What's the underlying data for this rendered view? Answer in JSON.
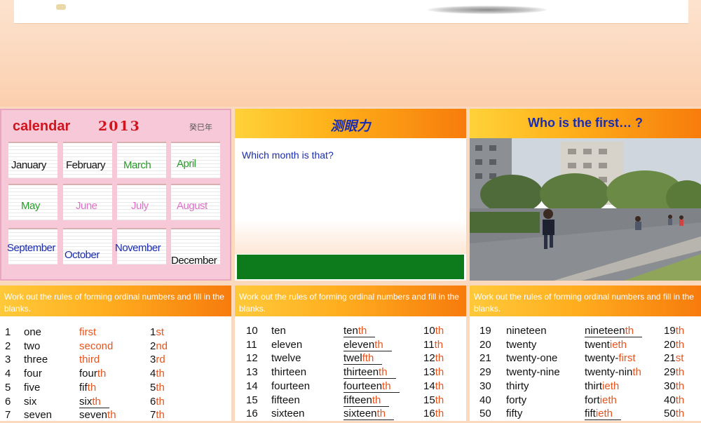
{
  "top_banner": {},
  "calendar_slide": {
    "title": "calendar",
    "year": "2013",
    "signature": "癸巳年",
    "months": [
      {
        "label": "January",
        "color": "#111111"
      },
      {
        "label": "February",
        "color": "#111111"
      },
      {
        "label": "March",
        "color": "#2a9a2a"
      },
      {
        "label": "April",
        "color": "#2a9a2a"
      },
      {
        "label": "May",
        "color": "#2a9a2a"
      },
      {
        "label": "June",
        "color": "#e070c8"
      },
      {
        "label": "July",
        "color": "#e070c8"
      },
      {
        "label": "August",
        "color": "#e070c8"
      },
      {
        "label": "September",
        "color": "#1a2cb0"
      },
      {
        "label": "October",
        "color": "#1a2cb0"
      },
      {
        "label": "November",
        "color": "#1a2cb0"
      },
      {
        "label": "December",
        "color": "#111111"
      }
    ]
  },
  "eye_slide": {
    "title": "测眼力",
    "question": "Which month is that?"
  },
  "first_slide": {
    "title": "Who is the first… ?"
  },
  "rules_header": "Work out the rules of forming ordinal numbers and fill in the blanks.",
  "tables": [
    {
      "rows": [
        {
          "n": "1",
          "word": "one",
          "ord_stem": "first",
          "ord_suf": "",
          "num": "1",
          "num_suf": "st",
          "underline": false,
          "stem_red": true
        },
        {
          "n": "2",
          "word": "two",
          "ord_stem": "second",
          "ord_suf": "",
          "num": "2",
          "num_suf": "nd",
          "underline": false,
          "stem_red": true
        },
        {
          "n": "3",
          "word": "three",
          "ord_stem": "third",
          "ord_suf": "",
          "num": "3",
          "num_suf": "rd",
          "underline": false,
          "stem_red": true
        },
        {
          "n": "4",
          "word": "four",
          "ord_stem": "four",
          "ord_suf": "th",
          "num": "4",
          "num_suf": "th",
          "underline": false,
          "stem_red": false
        },
        {
          "n": "5",
          "word": "five",
          "ord_stem": "fif",
          "ord_suf": "th",
          "num": "5",
          "num_suf": "th",
          "underline": false,
          "stem_red": false
        },
        {
          "n": "6",
          "word": "six",
          "ord_stem": "six",
          "ord_suf": "th",
          "num": "6",
          "num_suf": "th",
          "underline": true,
          "stem_red": false
        },
        {
          "n": "7",
          "word": "seven",
          "ord_stem": "seven",
          "ord_suf": "th",
          "num": "7",
          "num_suf": "th",
          "underline": false,
          "stem_red": false
        }
      ]
    },
    {
      "rows": [
        {
          "n": "10",
          "word": "ten",
          "ord_stem": "ten",
          "ord_suf": "th",
          "num": "10",
          "num_suf": "th",
          "underline": true,
          "stem_red": false
        },
        {
          "n": "11",
          "word": "eleven",
          "ord_stem": "eleven",
          "ord_suf": "th",
          "num": "11",
          "num_suf": "th",
          "underline": true,
          "stem_red": false
        },
        {
          "n": "12",
          "word": "twelve",
          "ord_stem": "twel",
          "ord_suf": "f",
          "ord_suf2": "th",
          "num": "12",
          "num_suf": "th",
          "underline": true,
          "stem_red": false
        },
        {
          "n": "13",
          "word": "thirteen",
          "ord_stem": "thirteen",
          "ord_suf": "th",
          "num": "13",
          "num_suf": "th",
          "underline": true,
          "stem_red": false
        },
        {
          "n": "14",
          "word": "fourteen",
          "ord_stem": "fourteen",
          "ord_suf": "th",
          "num": "14",
          "num_suf": "th",
          "underline": true,
          "stem_red": false
        },
        {
          "n": "15",
          "word": "fifteen",
          "ord_stem": "fifteen",
          "ord_suf": "th",
          "num": "15",
          "num_suf": "th",
          "underline": true,
          "stem_red": false
        },
        {
          "n": "16",
          "word": "sixteen",
          "ord_stem": "sixteen",
          "ord_suf": "th",
          "num": "16",
          "num_suf": "th",
          "underline": true,
          "stem_red": false
        }
      ]
    },
    {
      "rows": [
        {
          "n": "19",
          "word": "nineteen",
          "ord_stem": "nineteen",
          "ord_suf": "th",
          "num": "19",
          "num_suf": "th",
          "underline": true,
          "stem_red": false
        },
        {
          "n": "20",
          "word": "twenty",
          "ord_stem": "twent",
          "ord_suf": "ieth",
          "num": "20",
          "num_suf": "th",
          "underline": false,
          "stem_red": false
        },
        {
          "n": "21",
          "word": "twenty-one",
          "ord_stem": "twenty-",
          "ord_suf": "first",
          "num": "21",
          "num_suf": "st",
          "underline": false,
          "stem_red": false
        },
        {
          "n": "29",
          "word": "twenty-nine",
          "ord_stem": "twenty-nin",
          "ord_suf": "th",
          "num": "29",
          "num_suf": "th",
          "underline": false,
          "stem_red": false
        },
        {
          "n": "30",
          "word": "thirty",
          "ord_stem": "thirt",
          "ord_suf": "ieth",
          "num": "30",
          "num_suf": "th",
          "underline": false,
          "stem_red": false
        },
        {
          "n": "40",
          "word": "forty",
          "ord_stem": "fort",
          "ord_suf": "ieth",
          "num": "40",
          "num_suf": "th",
          "underline": false,
          "stem_red": false
        },
        {
          "n": "50",
          "word": "fifty",
          "ord_stem": "fift",
          "ord_suf": "ieth",
          "num": "50",
          "num_suf": "th",
          "underline": true,
          "stem_red": false
        }
      ]
    }
  ]
}
